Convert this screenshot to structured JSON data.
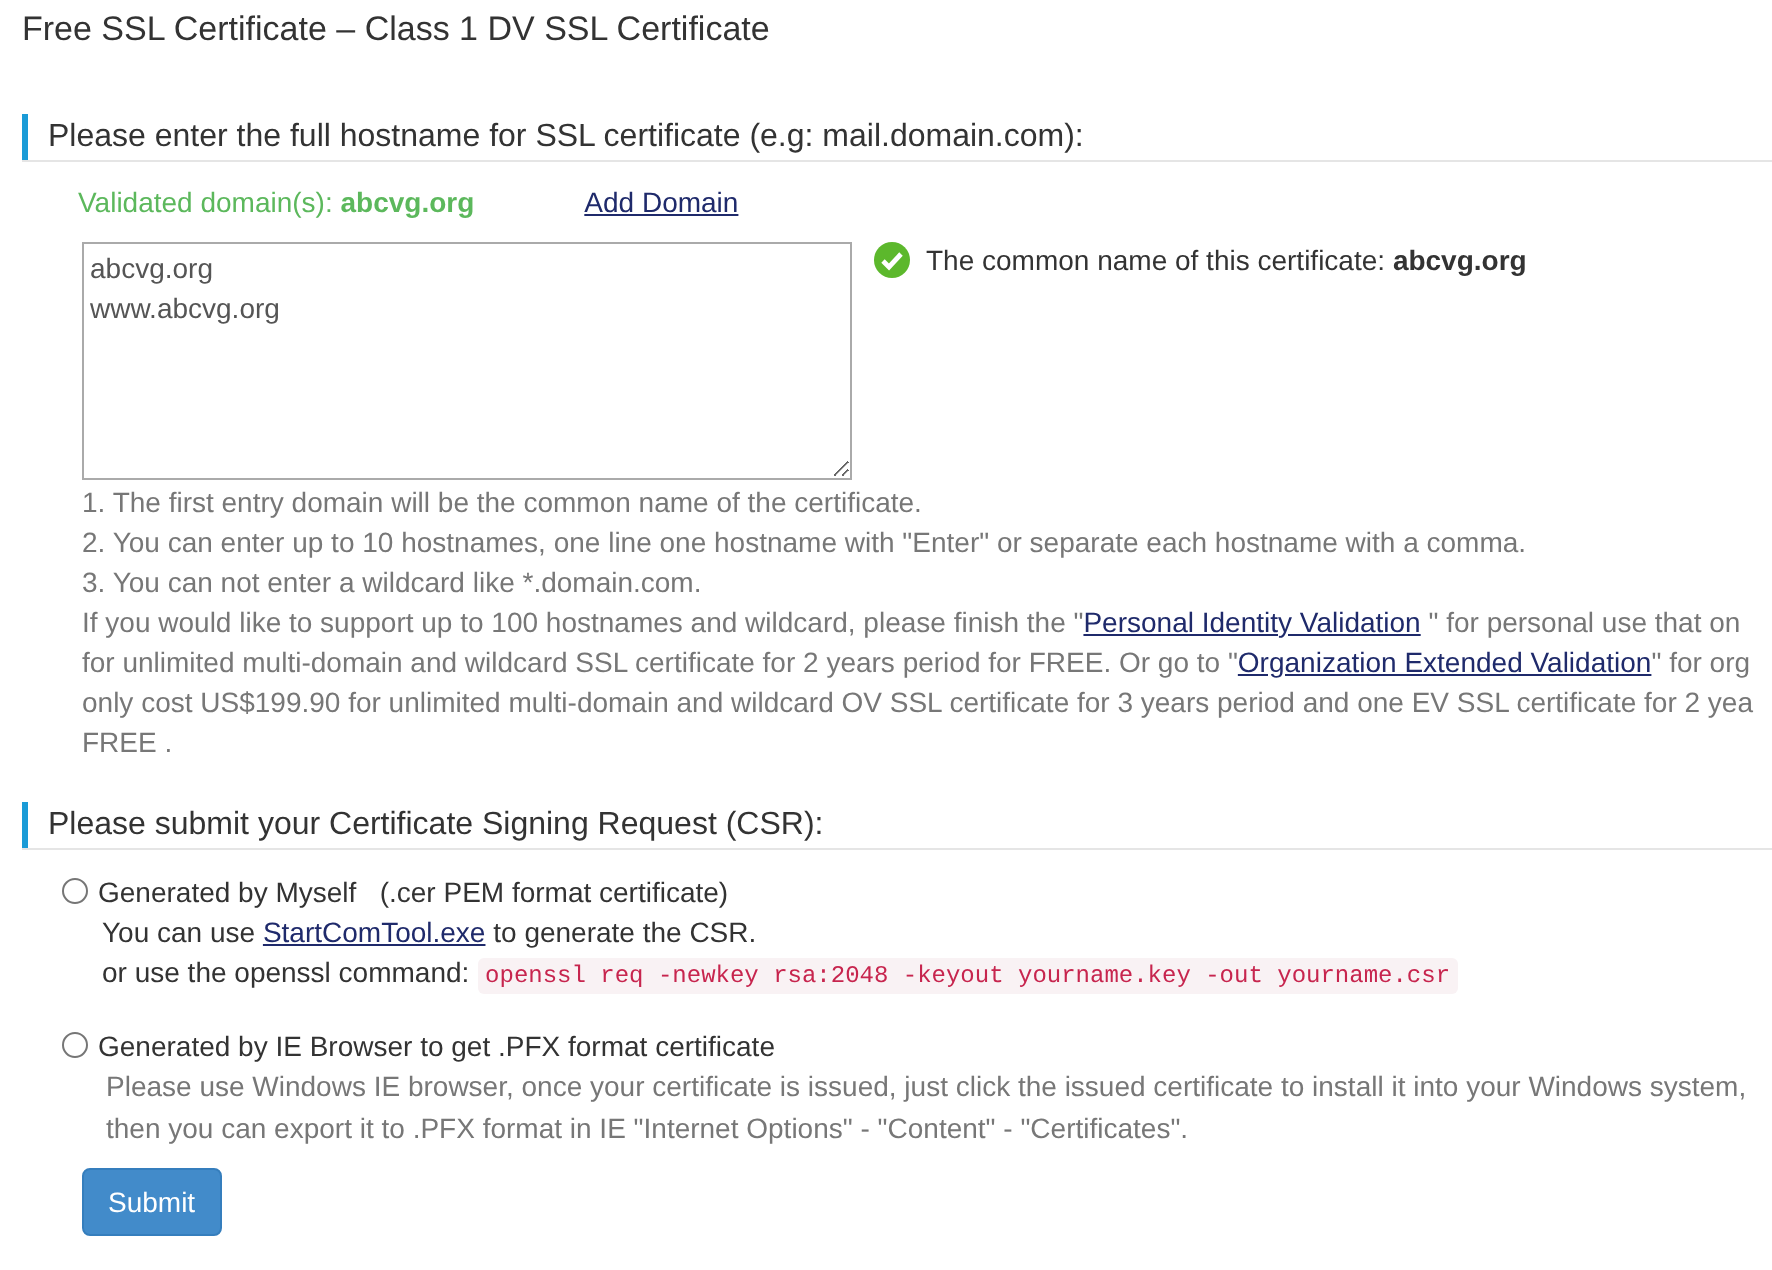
{
  "page_title": "Free SSL Certificate – Class 1 DV SSL Certificate",
  "hostname_section": {
    "heading": "Please enter the full hostname for SSL certificate (e.g: mail.domain.com):",
    "validated_label": "Validated domain(s):",
    "validated_domain": "abcvg.org",
    "add_domain_link": "Add Domain",
    "hostnames_value": "abcvg.org\nwww.abcvg.org",
    "common_name_label": "The common name of this certificate:",
    "common_name": "abcvg.org",
    "notes": [
      "1. The first entry domain will be the common name of the certificate.",
      "2. You can enter up to 10 hostnames, one line one hostname with \"Enter\" or separate each hostname with a comma.",
      "3. You can not enter a wildcard like *.domain.com."
    ],
    "upgrade_lines": [
      [
        {
          "text": "If you would like to support up to 100 hostnames and wildcard, please finish the \""
        },
        {
          "text": "Personal Identity Validation",
          "link": true
        },
        {
          "text": " \" for personal use that on"
        }
      ],
      [
        {
          "text": "for unlimited multi-domain and wildcard SSL certificate for 2 years period for FREE. Or go to \""
        },
        {
          "text": "Organization Extended Validation",
          "link": true
        },
        {
          "text": "\" for org"
        }
      ],
      [
        {
          "text": "only cost US$199.90 for unlimited multi-domain and wildcard OV SSL certificate for 3 years period and one EV SSL certificate for 2 yea"
        }
      ],
      [
        {
          "text": "FREE ."
        }
      ]
    ]
  },
  "csr_section": {
    "heading": "Please submit your Certificate Signing Request (CSR):",
    "options": [
      {
        "label": "Generated by Myself   (.cer PEM format certificate)",
        "selected": false,
        "kind": "pem",
        "tool_prefix": "You can use ",
        "tool_link": "StartComTool.exe",
        "tool_suffix": " to generate the CSR.",
        "command_label": "or use the openssl command:",
        "command": "openssl req -newkey rsa:2048 -keyout yourname.key -out yourname.csr"
      },
      {
        "label": "Generated by IE Browser to get .PFX format certificate",
        "selected": false,
        "kind": "pfx",
        "description_lines": [
          "Please use Windows IE browser, once your certificate is issued, just click the issued certificate to install it into your Windows system,",
          "then you can export it to .PFX format in IE \"Internet Options\" - \"Content\" - \"Certificates\"."
        ]
      }
    ]
  },
  "submit_button": "Submit"
}
